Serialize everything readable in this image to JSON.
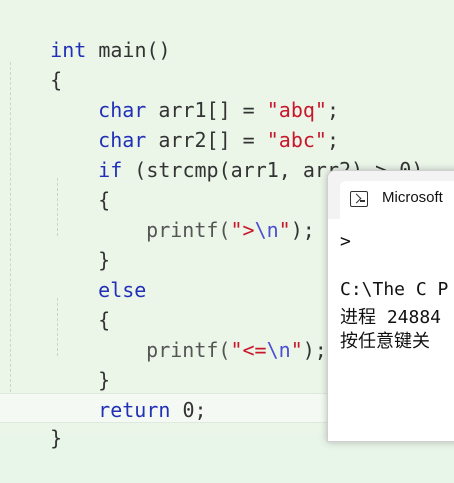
{
  "editor": {
    "lines": {
      "l1_kw": "int",
      "l1_rest": " main()",
      "l2": "{",
      "l3_kw": "char",
      "l3_mid": " arr1[] = ",
      "l3_str": "\"abq\"",
      "l3_end": ";",
      "l4_kw": "char",
      "l4_mid": " arr2[] = ",
      "l4_str": "\"abc\"",
      "l4_end": ";",
      "l5_kw": "if",
      "l5_rest": " (strcmp(arr1, arr2) > 0)",
      "l6": "{",
      "l7_fn": "printf(",
      "l7_str": "\">",
      "l7_esc": "\\n",
      "l7_str2": "\"",
      "l7_end": ");",
      "l8": "}",
      "l9_kw": "else",
      "l10": "{",
      "l11_fn": "printf(",
      "l11_str": "\"<=",
      "l11_esc": "\\n",
      "l11_str2": "\"",
      "l11_end": ");",
      "l12": "}",
      "l13_kw": "return",
      "l13_rest": " 0;",
      "l14": "}"
    }
  },
  "console": {
    "title": "Microsoft",
    "output_line1": ">",
    "output_line2": "C:\\The C P",
    "output_line3": "进程 24884",
    "output_line4": "按任意键关"
  }
}
